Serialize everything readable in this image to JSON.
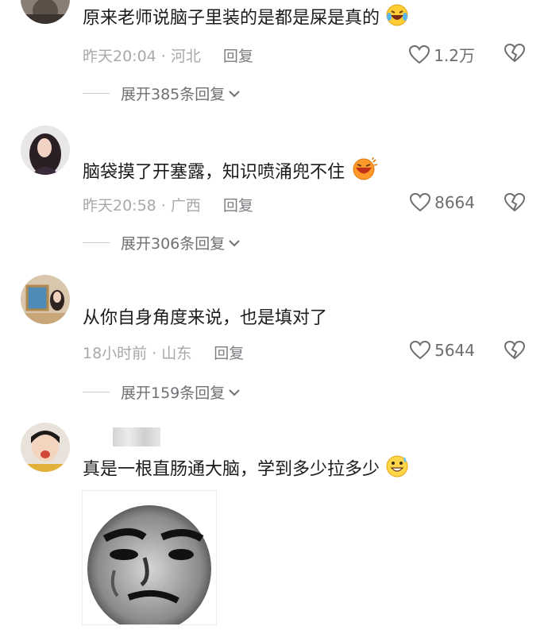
{
  "comments": [
    {
      "text": "原来老师说脑子里装的是都是屎是真的",
      "time": "昨天20:04",
      "location": "河北",
      "reply_label": "回复",
      "likes": "1.2万",
      "expand_label": "展开385条回复",
      "emoji": "laughing-tears"
    },
    {
      "text": "脑袋摸了开塞露，知识喷涌兜不住",
      "time": "昨天20:58",
      "location": "广西",
      "reply_label": "回复",
      "likes": "8664",
      "expand_label": "展开306条回复",
      "emoji": "big-laugh"
    },
    {
      "text": "从你自身角度来说，也是填对了",
      "time": "18小时前",
      "location": "山东",
      "reply_label": "回复",
      "likes": "5644",
      "expand_label": "展开159条回复"
    },
    {
      "text": "真是一根直肠通大脑，学到多少拉多少",
      "emoji": "grinning-sweat",
      "sticker": "meme-face-sticker"
    }
  ],
  "icons": {
    "like": "heart-outline-icon",
    "dislike": "broken-heart-icon",
    "expand": "chevron-down-icon"
  },
  "colors": {
    "text": "#1c1c1e",
    "meta": "#a8a8ad",
    "reply": "#7d7d82"
  }
}
